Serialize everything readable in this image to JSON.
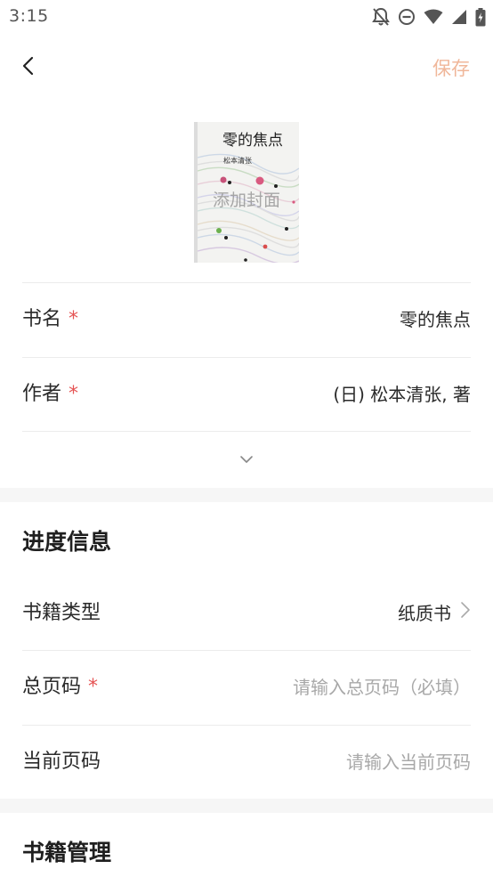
{
  "status_bar": {
    "time": "3:15",
    "icons": [
      "bell-off-icon",
      "do-not-disturb-icon",
      "wifi-icon",
      "signal-icon",
      "battery-icon"
    ]
  },
  "nav": {
    "back_icon": "chevron-left-icon",
    "save_label": "保存",
    "save_color": "#f0b79a"
  },
  "cover": {
    "title": "零的焦点",
    "author": "松本清张",
    "overlay_label": "添加封面"
  },
  "basic_info": {
    "title_label": "书名",
    "title_value": "零的焦点",
    "author_label": "作者",
    "author_value": "(日) 松本清张, 著",
    "required_mark": "*",
    "expand_icon": "chevron-down-icon"
  },
  "progress_section": {
    "heading": "进度信息",
    "book_type_label": "书籍类型",
    "book_type_value": "纸质书",
    "total_pages_label": "总页码",
    "total_pages_placeholder": "请输入总页码（必填）",
    "current_page_label": "当前页码",
    "current_page_placeholder": "请输入当前页码"
  },
  "management_section": {
    "heading": "书籍管理"
  },
  "colors": {
    "required": "#e55454",
    "placeholder": "#a8a8a8",
    "section_gap": "#f6f6f6"
  }
}
